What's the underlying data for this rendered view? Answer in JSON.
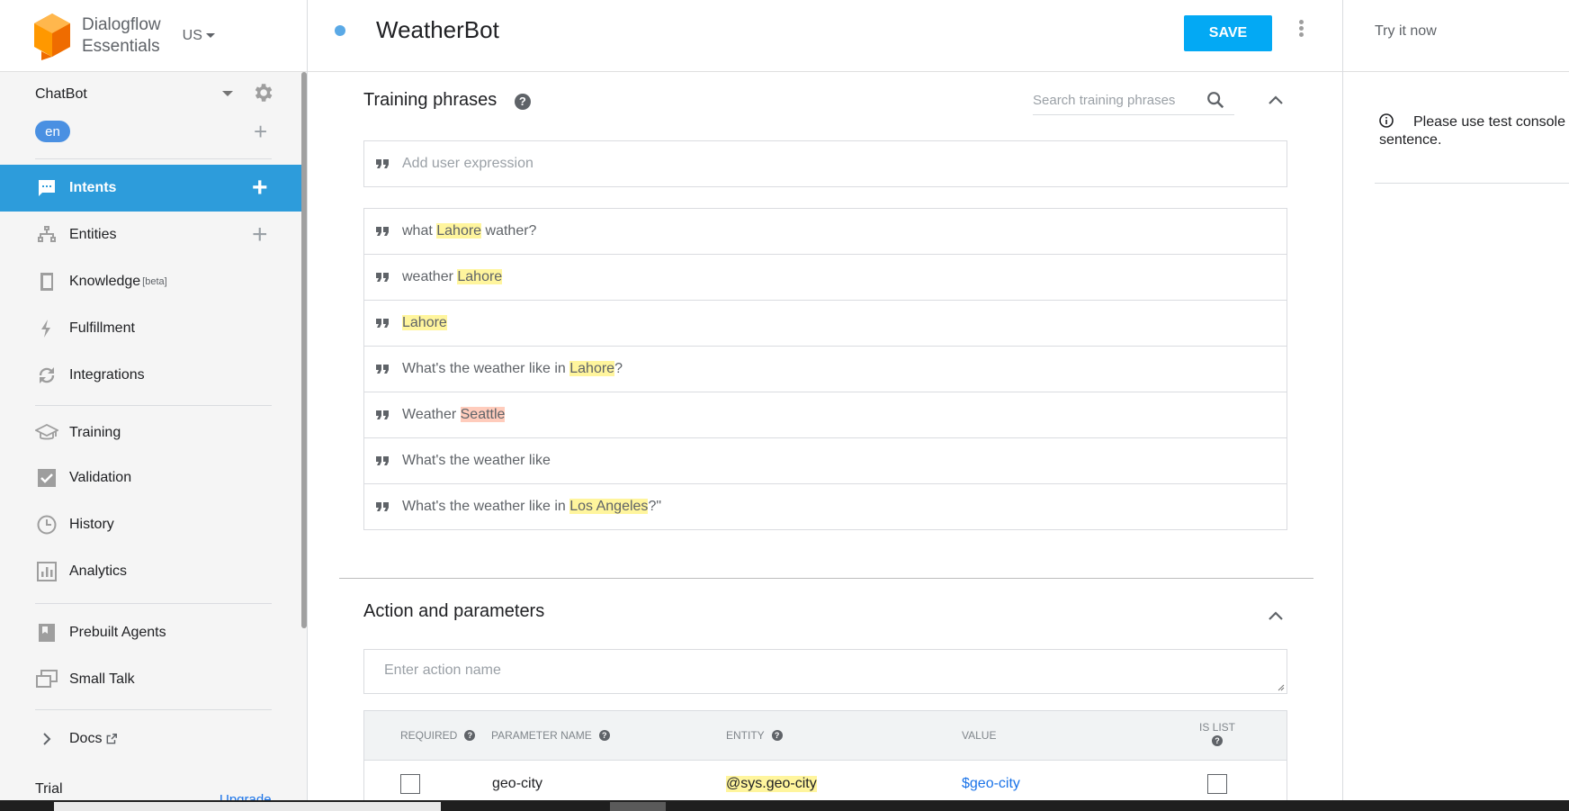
{
  "app": {
    "brand_line1": "Dialogflow",
    "brand_line2": "Essentials",
    "region": "US"
  },
  "agent": {
    "name": "ChatBot",
    "language": "en"
  },
  "sidebar": {
    "items": [
      {
        "label": "Intents",
        "icon": "chat-icon",
        "active": true
      },
      {
        "label": "Entities",
        "icon": "hierarchy-icon"
      },
      {
        "label": "Knowledge",
        "icon": "book-icon",
        "sup": "[beta]"
      },
      {
        "label": "Fulfillment",
        "icon": "bolt-icon"
      },
      {
        "label": "Integrations",
        "icon": "sync-icon"
      },
      {
        "label": "Training",
        "icon": "graduation-cap-icon"
      },
      {
        "label": "Validation",
        "icon": "check-square-icon"
      },
      {
        "label": "History",
        "icon": "clock-icon"
      },
      {
        "label": "Analytics",
        "icon": "bar-chart-icon"
      },
      {
        "label": "Prebuilt Agents",
        "icon": "bookmark-icon"
      },
      {
        "label": "Small Talk",
        "icon": "chat-bubbles-icon"
      },
      {
        "label": "Docs",
        "icon": "chevron-right-icon"
      }
    ],
    "trial": "Trial",
    "upgrade": "Upgrade"
  },
  "header": {
    "intent_name": "WeatherBot",
    "save_label": "SAVE"
  },
  "training": {
    "title": "Training phrases",
    "search_placeholder": "Search training phrases",
    "add_placeholder": "Add user expression",
    "phrases": [
      {
        "parts": [
          {
            "t": "what "
          },
          {
            "t": "Lahore",
            "hl": "yellow"
          },
          {
            "t": " wather?"
          }
        ]
      },
      {
        "parts": [
          {
            "t": "weather "
          },
          {
            "t": "Lahore",
            "hl": "yellow"
          }
        ]
      },
      {
        "parts": [
          {
            "t": "Lahore",
            "hl": "yellow"
          }
        ]
      },
      {
        "parts": [
          {
            "t": "What's the weather like in "
          },
          {
            "t": "Lahore",
            "hl": "yellow"
          },
          {
            "t": "?"
          }
        ]
      },
      {
        "parts": [
          {
            "t": "Weather "
          },
          {
            "t": "Seattle",
            "hl": "orange"
          }
        ]
      },
      {
        "parts": [
          {
            "t": "What's the weather like"
          }
        ]
      },
      {
        "parts": [
          {
            "t": "What's the weather like in "
          },
          {
            "t": "Los Angeles",
            "hl": "yellow"
          },
          {
            "t": "?\""
          }
        ]
      }
    ]
  },
  "action": {
    "title": "Action and parameters",
    "action_placeholder": "Enter action name",
    "columns": {
      "required": "REQUIRED",
      "param_name": "PARAMETER NAME",
      "entity": "ENTITY",
      "value": "VALUE",
      "is_list": "IS LIST"
    },
    "rows": [
      {
        "required": false,
        "name": "geo-city",
        "entity": "@sys.geo-city",
        "value": "$geo-city",
        "is_list": false
      }
    ]
  },
  "test_console": {
    "try_now": "Try it now",
    "info_line1": "Please use test console a",
    "info_line2": "sentence."
  },
  "colors": {
    "accent": "#2d9cdb",
    "save": "#03a9f4",
    "highlight_yellow": "#fff59d",
    "highlight_orange": "#ffccbc",
    "link": "#1a73e8"
  }
}
